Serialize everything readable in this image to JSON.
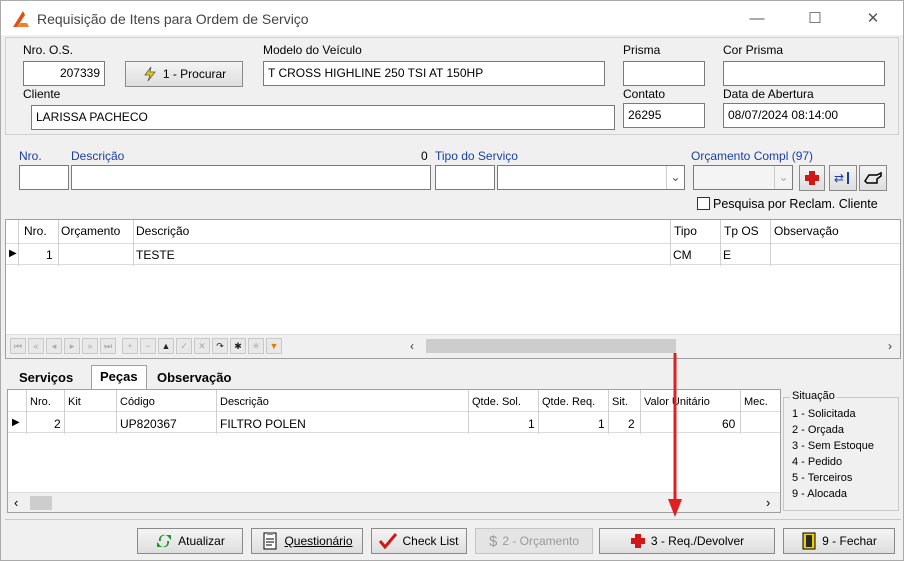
{
  "window": {
    "title": "Requisição de Itens para Ordem de Serviço",
    "minimize": "—",
    "maximize": "☐",
    "close": "✕"
  },
  "header": {
    "os_label": "Nro. O.S.",
    "os_value": "207339",
    "procurar_label": "1 - Procurar",
    "modelo_label": "Modelo do Veículo",
    "modelo_value": "T CROSS HIGHLINE 250 TSI AT 150HP",
    "prisma_label": "Prisma",
    "prisma_value": "",
    "cor_prisma_label": "Cor Prisma",
    "cor_prisma_value": "",
    "cliente_label": "Cliente",
    "cliente_value": "LARISSA PACHECO",
    "contato_label": "Contato",
    "contato_value": "26295",
    "abertura_label": "Data de Abertura",
    "abertura_value": "08/07/2024 08:14:00"
  },
  "service_entry": {
    "nro_label": "Nro.",
    "descricao_label": "Descrição",
    "count": "0",
    "tipo_label": "Tipo do Serviço",
    "orcamento_label": "Orçamento Compl (97)",
    "pesquisa_label": "Pesquisa por Reclam. Cliente"
  },
  "services_grid": {
    "columns": [
      "Nro.",
      "Orçamento",
      "Descrição",
      "Tipo",
      "Tp OS",
      "Observação"
    ],
    "rows": [
      {
        "nro": "1",
        "orcamento": "",
        "descricao": "TESTE",
        "tipo": "CM",
        "tp_os": "E",
        "observacao": ""
      }
    ]
  },
  "tabs": {
    "servicos": "Serviços",
    "pecas": "Peças",
    "observacao": "Observação"
  },
  "parts_grid": {
    "columns": [
      "Nro.",
      "Kit",
      "Código",
      "Descrição",
      "Qtde. Sol.",
      "Qtde. Req.",
      "Sit.",
      "Valor Unitário",
      "Mec."
    ],
    "rows": [
      {
        "nro": "2",
        "kit": "",
        "codigo": "UP820367",
        "descricao": "FILTRO POLEN",
        "qtde_sol": "1",
        "qtde_req": "1",
        "sit": "2",
        "valor": "60",
        "mec": ""
      }
    ]
  },
  "situacao": {
    "title": "Situação",
    "items": [
      "1 - Solicitada",
      "2 - Orçada",
      "3 - Sem Estoque",
      "4 - Pedido",
      "5 - Terceiros",
      "9 - Alocada"
    ]
  },
  "footer": {
    "atualizar": "Atualizar",
    "questionario": "Questionário",
    "checklist": "Check List",
    "orcamento": "2 - Orçamento",
    "req_devolver": "3 - Req./Devolver",
    "fechar": "9 - Fechar"
  },
  "colors": {
    "accent_blue": "#1a3ea8",
    "arrow_red": "#e02020"
  }
}
